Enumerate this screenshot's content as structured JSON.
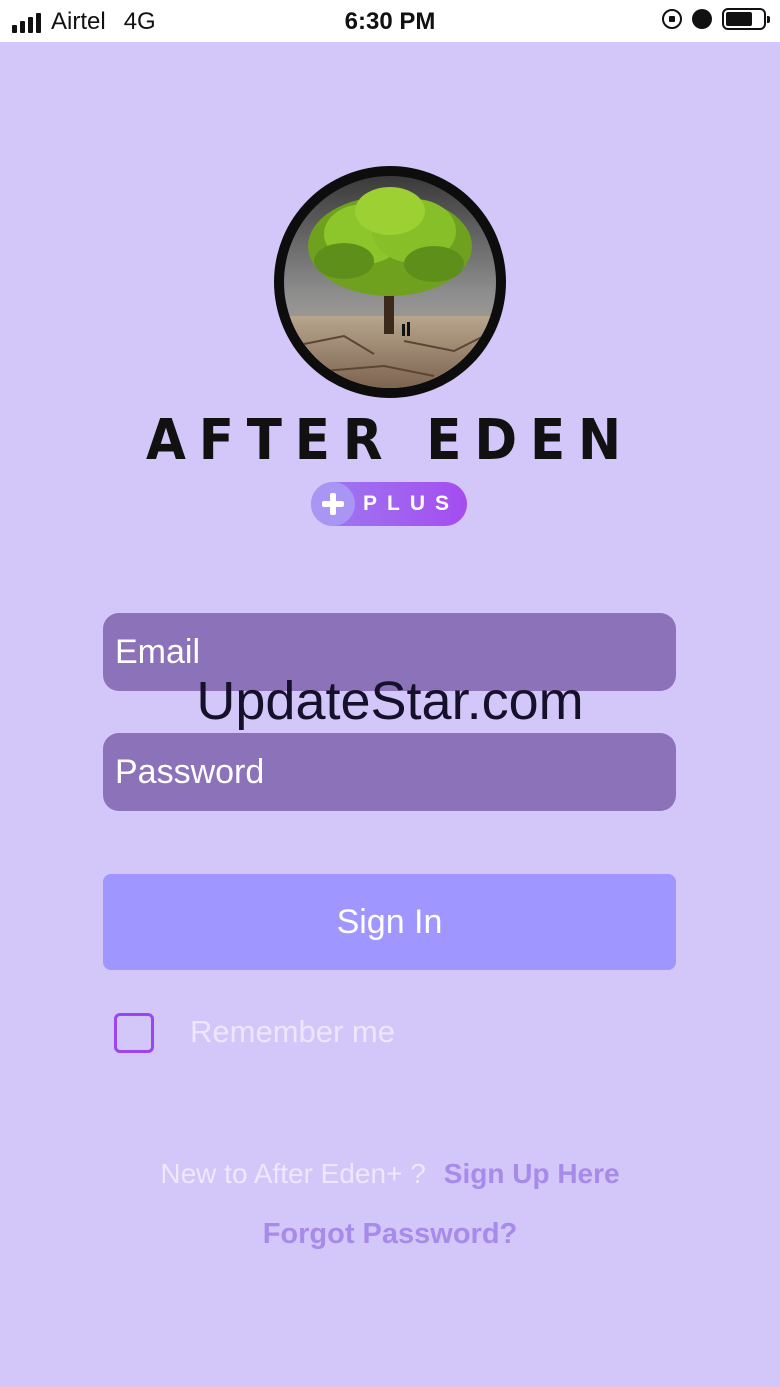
{
  "status_bar": {
    "carrier": "Airtel",
    "network": "4G",
    "time": "6:30 PM",
    "icons": [
      "signal-icon",
      "orientation-lock-icon",
      "alarm-icon",
      "battery-icon"
    ]
  },
  "brand": {
    "name": "AFTER EDEN",
    "plus_label": "PLUS"
  },
  "login_form": {
    "email_placeholder": "Email",
    "password_placeholder": "Password",
    "sign_in_label": "Sign In",
    "remember_me_label": "Remember me",
    "remember_me_checked": false
  },
  "watermark": "UpdateStar.com",
  "footer": {
    "signup_prompt": "New to After Eden+ ?",
    "signup_link": "Sign Up Here",
    "forgot_password": "Forgot Password?"
  },
  "colors": {
    "background": "#d3c6f8",
    "field_fill": "#8c72b9",
    "button_fill": "#a096ff",
    "link": "#a78bea",
    "checkbox_border": "#9b45ef"
  }
}
